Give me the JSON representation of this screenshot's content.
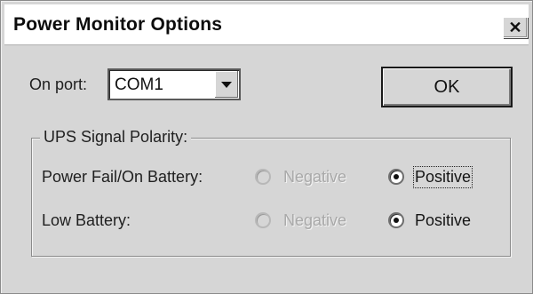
{
  "window": {
    "title": "Power Monitor Options",
    "close_glyph": "✕"
  },
  "port": {
    "label": "On port:",
    "value": "COM1"
  },
  "ok_label": "OK",
  "group": {
    "title": "UPS Signal Polarity:",
    "rows": [
      {
        "label": "Power Fail/On Battery:",
        "negative": "Negative",
        "positive": "Positive",
        "selected": "Positive"
      },
      {
        "label": "Low Battery:",
        "negative": "Negative",
        "positive": "Positive",
        "selected": "Positive"
      }
    ]
  },
  "icons": {
    "close": "close-icon",
    "dropdown": "dropdown-arrow-icon"
  }
}
